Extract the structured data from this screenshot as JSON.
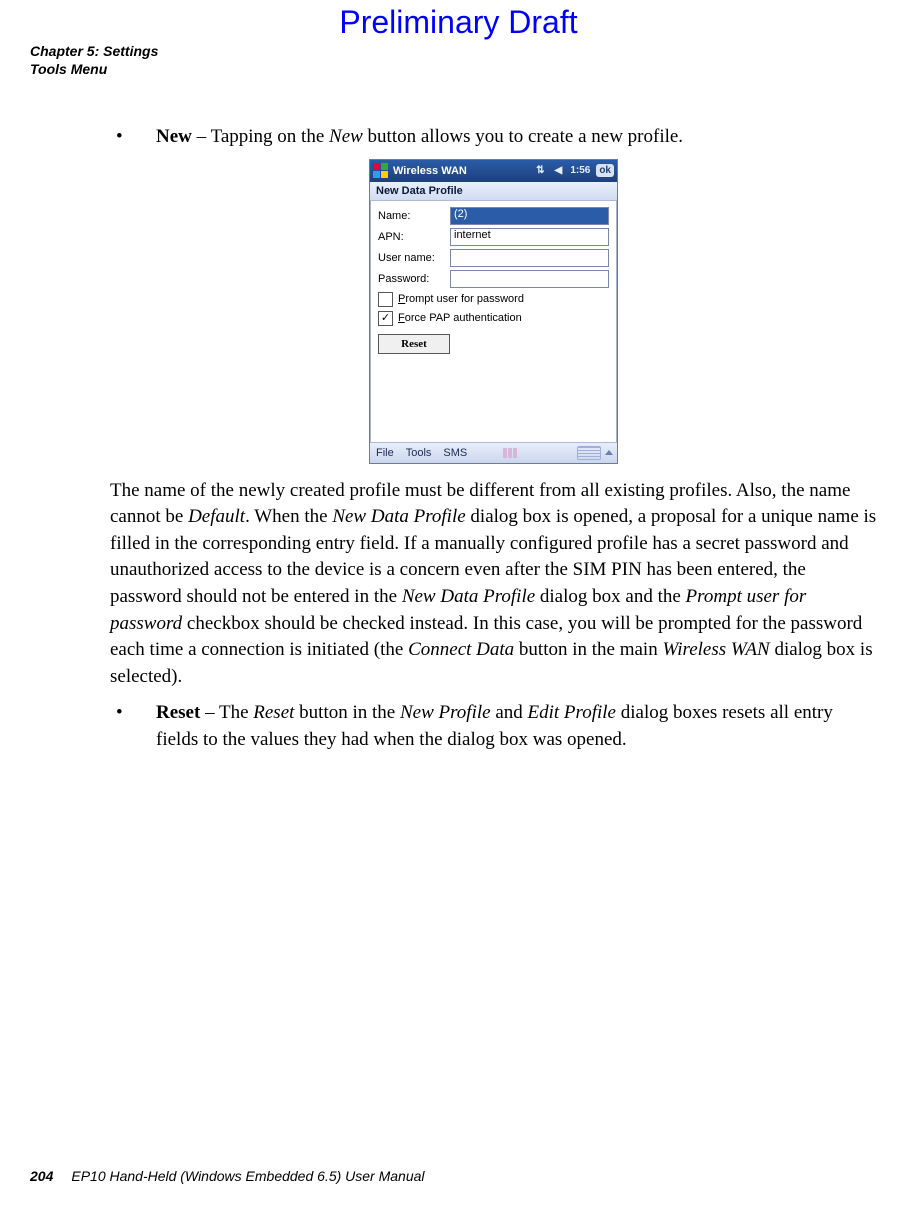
{
  "draft_title": "Preliminary Draft",
  "chapter_line1": "Chapter 5: Settings",
  "chapter_line2": "Tools Menu",
  "bullets": {
    "new": {
      "label": "New",
      "dash": " – ",
      "text_before_italic": "Tapping on the ",
      "italic": "New",
      "text_after": " button allows you to create a new profile."
    },
    "reset": {
      "label": "Reset",
      "dash": " – The ",
      "i1": "Reset",
      "t2": " button in the ",
      "i2": "New Profile",
      "t3": " and ",
      "i3": "Edit Profile",
      "t4": " dialog boxes resets all entry fields to the values they had when the dialog box was opened."
    }
  },
  "paragraph": {
    "p1": "The name of the newly created profile must be different from all existing profiles. Also, the name cannot be ",
    "i1": "Default",
    "p2": ". When the ",
    "i2": "New Data Profile",
    "p3": " dialog box is opened, a proposal for a unique name is filled in the corresponding entry field. If a manually configured profile has a secret password and unauthorized access to the device is a concern even after the SIM PIN has been entered, the password should not be entered in the ",
    "i3": "New Data Profile",
    "p4": " dialog box and the ",
    "i4": "Prompt user for password",
    "p5": " checkbox should be checked instead. In this case, you will be prompted for the password each time a connection is initiated (the ",
    "i5": "Connect Data",
    "p6": " button in the main ",
    "i6": "Wireless WAN",
    "p7": " dialog box is selected)."
  },
  "dialog": {
    "title": "Wireless WAN",
    "time": "1:56",
    "ok": "ok",
    "subtitle": "New Data Profile",
    "labels": {
      "name": "Name:",
      "apn": "APN:",
      "user": "User name:",
      "pass": "Password:"
    },
    "values": {
      "name": "(2)",
      "apn": "internet",
      "user": "",
      "pass": ""
    },
    "checks": {
      "prompt": "Prompt user for password",
      "force": "Force PAP authentication",
      "prompt_checked": false,
      "force_checked": true
    },
    "reset_button": "Reset",
    "menus": {
      "m1": "File",
      "m2": "Tools",
      "m3": "SMS"
    }
  },
  "footer": {
    "page": "204",
    "manual": "EP10 Hand-Held (Windows Embedded 6.5) User Manual"
  }
}
